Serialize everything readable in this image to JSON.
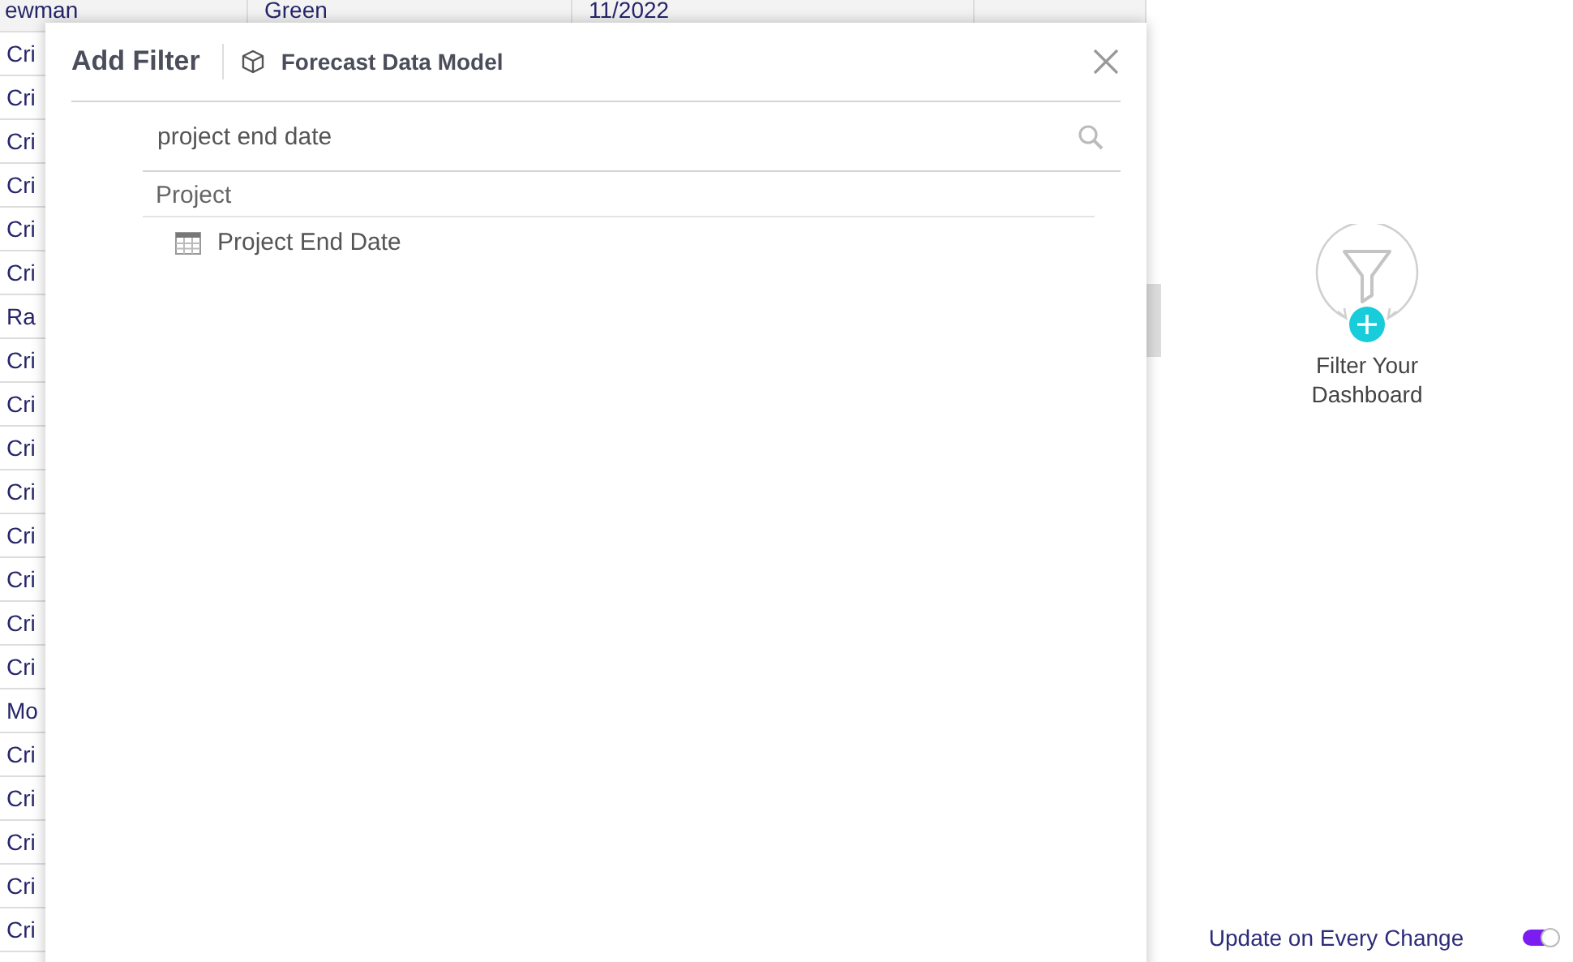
{
  "table": {
    "top_row": [
      "ewman",
      "Green",
      "11/2022"
    ],
    "rows": [
      "Cri",
      "Cri",
      "Cri",
      "Cri",
      "Cri",
      "Cri",
      "Ra",
      "Cri",
      "Cri",
      "Cri",
      "Cri",
      "Cri",
      "Cri",
      "Cri",
      "Cri",
      "Mo",
      "Cri",
      "Cri",
      "Cri",
      "Cri",
      "Cri"
    ]
  },
  "dialog": {
    "title": "Add Filter",
    "model": "Forecast Data Model",
    "search": {
      "value": "project end date"
    },
    "groups": [
      {
        "label": "Project",
        "items": [
          {
            "label": "Project End Date"
          }
        ]
      }
    ]
  },
  "side_panel": {
    "empty_state": "Filter Your Dashboard",
    "update_toggle": {
      "label": "Update on Every Change",
      "on": true
    }
  }
}
